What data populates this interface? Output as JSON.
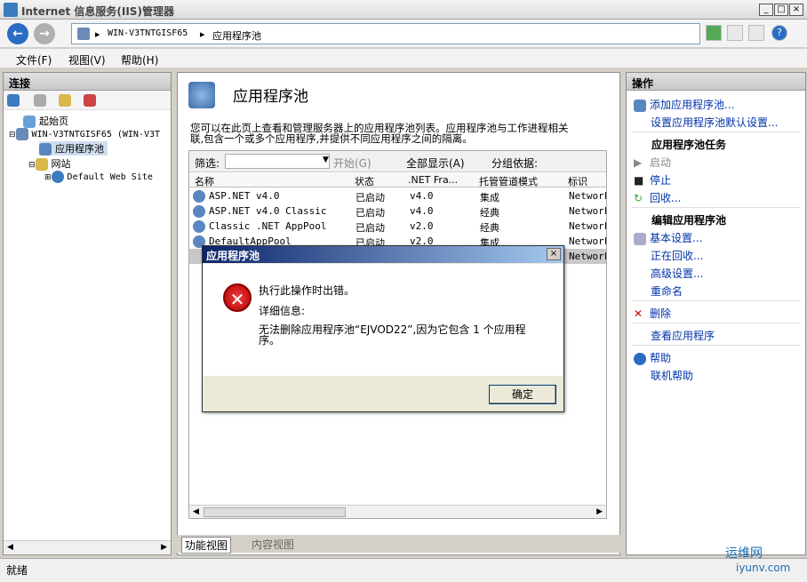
{
  "window": {
    "title": "Internet 信息服务(IIS)管理器",
    "min_label": "_",
    "max_label": "□",
    "close_label": "×"
  },
  "address": {
    "nav_back": "←",
    "nav_fwd": "→",
    "sep": "▸",
    "server": "WIN-V3TNTGISF65",
    "page": "应用程序池"
  },
  "menu": {
    "file": "文件(F)",
    "view": "视图(V)",
    "help": "帮助(H)"
  },
  "connections": {
    "title": "连接",
    "tree": {
      "start": "起始页",
      "server": "WIN-V3TNTGISF65 (WIN-V3T",
      "app_pools": "应用程序池",
      "sites": "网站",
      "default_site": "Default Web Site"
    }
  },
  "main": {
    "title": "应用程序池",
    "description_line1": "您可以在此页上查看和管理服务器上的应用程序池列表。应用程序池与工作进程相关",
    "description_line2": "联,包含一个或多个应用程序,并提供不同应用程序之间的隔离。",
    "filter": {
      "label": "筛选:",
      "start": "开始(G)",
      "show_all": "全部显示(A)",
      "group_by": "分组依据:"
    },
    "columns": [
      "名称",
      "状态",
      ".NET Fra...",
      "托管管道模式",
      "标识"
    ],
    "rows": [
      {
        "name": "ASP.NET v4.0",
        "status": "已启动",
        "net": "v4.0",
        "mode": "集成",
        "identity": "Network"
      },
      {
        "name": "ASP.NET v4.0 Classic",
        "status": "已启动",
        "net": "v4.0",
        "mode": "经典",
        "identity": "Network"
      },
      {
        "name": "Classic .NET AppPool",
        "status": "已启动",
        "net": "v2.0",
        "mode": "经典",
        "identity": "Network"
      },
      {
        "name": "DefaultAppPool",
        "status": "已启动",
        "net": "v2.0",
        "mode": "集成",
        "identity": "Network"
      },
      {
        "name": "",
        "status": "",
        "net": "",
        "mode": "",
        "identity": "Network"
      }
    ],
    "view_tabs": {
      "features": "功能视图",
      "content": "内容视图"
    }
  },
  "actions": {
    "title": "操作",
    "add_pool": "添加应用程序池...",
    "set_defaults": "设置应用程序池默认设置...",
    "tasks_header": "应用程序池任务",
    "start": "启动",
    "stop": "停止",
    "recycle": "回收...",
    "edit_header": "编辑应用程序池",
    "basic_settings": "基本设置...",
    "recycling": "正在回收...",
    "advanced_settings": "高级设置...",
    "rename": "重命名",
    "delete": "删除",
    "view_apps": "查看应用程序",
    "help": "帮助",
    "online_help": "联机帮助"
  },
  "dialog": {
    "title": "应用程序池",
    "close": "×",
    "message": "执行此操作时出错。",
    "details_label": "详细信息:",
    "details_line1": "无法删除应用程序池“EJVOD22”,因为它包含 1 个应用程",
    "details_line2": "序。",
    "ok": "确定",
    "icon_glyph": "✕"
  },
  "status": {
    "text": "就绪"
  },
  "watermark": {
    "site": "运维网",
    "url": "iyunv.com"
  },
  "colors": {
    "accent": "#0a246a",
    "link": "#0033aa",
    "error": "#c00000"
  }
}
